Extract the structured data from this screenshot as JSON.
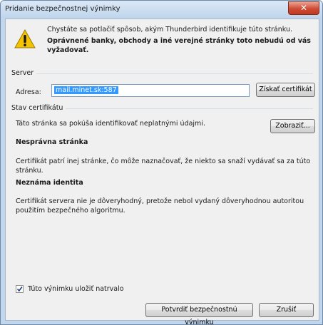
{
  "window": {
    "title": "Pridanie bezpečnostnej výnimky",
    "close_glyph": "✕"
  },
  "message": {
    "line1": "Chystáte sa potlačiť spôsob, akým Thunderbird identifikuje túto stránku.",
    "line2": "Oprávnené banky, obchody a iné verejné stránky toto nebudú od vás vyžadovať.",
    "icon": "warning-icon"
  },
  "server": {
    "group_label": "Server",
    "address_label": "Adresa:",
    "address_value": "mail.minet.sk:587",
    "get_cert_button": "Získať certifikát"
  },
  "cert": {
    "group_label": "Stav certifikátu",
    "status_text": "Táto stránka sa pokúša identifikovať neplatnými údajmi.",
    "show_button": "Zobraziť...",
    "wrong_site_heading": "Nesprávna stránka",
    "wrong_site_text": "Certifikát patrí inej stránke, čo môže naznačovať, že niekto sa snaží vydávať sa za túto stránku.",
    "unknown_heading": "Neznáma identita",
    "unknown_text": "Certifikát servera nie je dôveryhodný, pretože nebol vydaný dôveryhodnou autoritou použitím bezpečného algoritmu."
  },
  "footer": {
    "permanent_label": "Túto výnimku uložiť natrvalo",
    "permanent_checked": true,
    "confirm_button": "Potvrdiť bezpečnostnú výnimku",
    "cancel_button": "Zrušiť"
  },
  "colors": {
    "selection": "#3399ff",
    "close_button": "#cf4b32",
    "frame": "#c2d7ee"
  }
}
